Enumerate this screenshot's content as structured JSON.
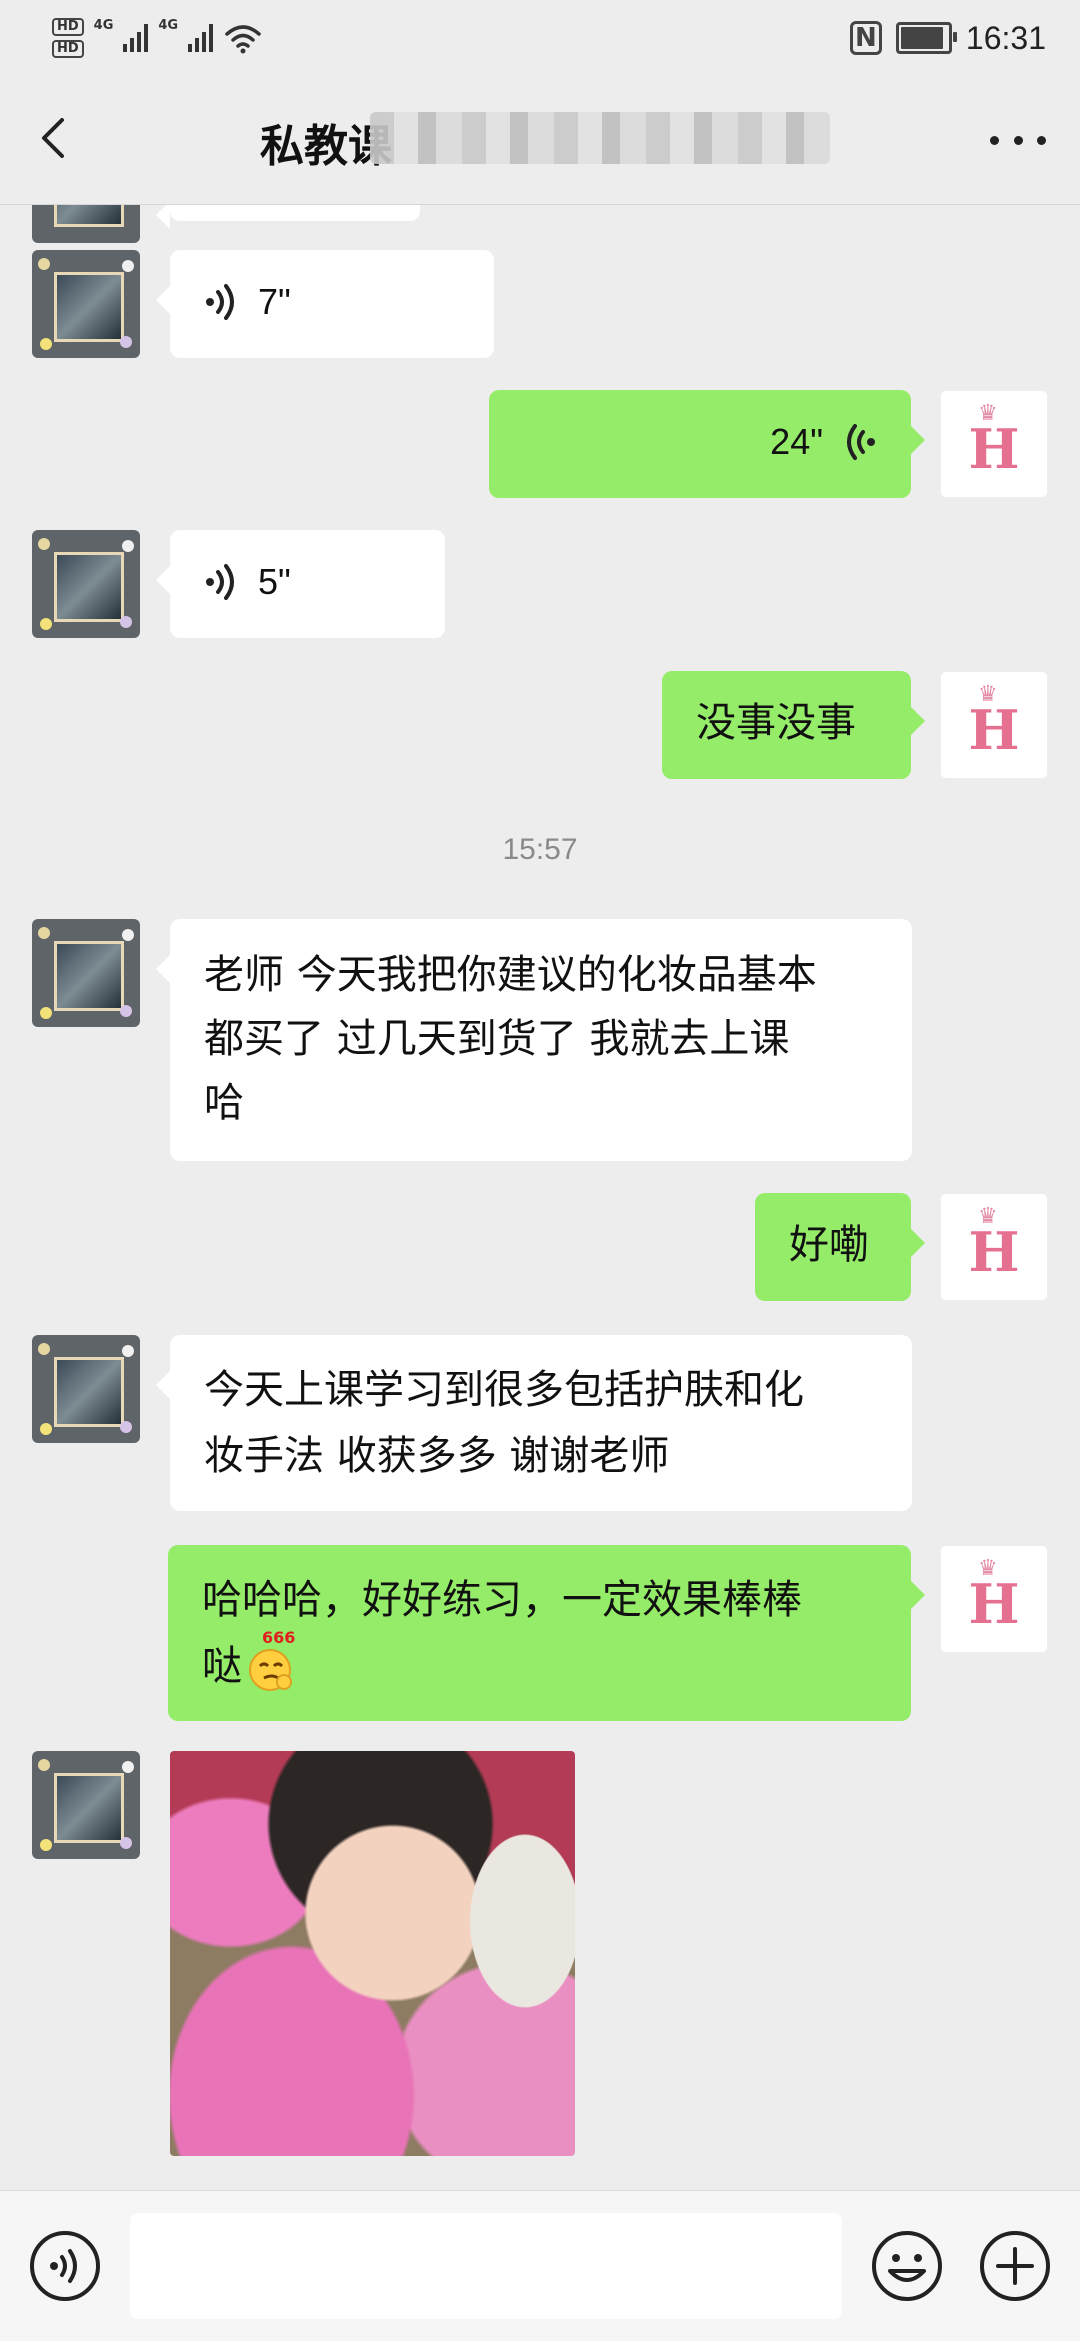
{
  "status_bar": {
    "hd1": "HD",
    "hd2": "HD",
    "net1": "4G",
    "net2": "4G",
    "nfc": "N",
    "time": "16:31"
  },
  "nav": {
    "title": "私教课",
    "more_label": "more options"
  },
  "messages": {
    "m1": {
      "side": "left",
      "type": "voice",
      "duration": "7\""
    },
    "m2": {
      "side": "right",
      "type": "voice",
      "duration": "24\""
    },
    "m3": {
      "side": "left",
      "type": "voice",
      "duration": "5\""
    },
    "m4": {
      "side": "right",
      "type": "text",
      "text": "没事没事"
    },
    "ts1": "15:57",
    "m5": {
      "side": "left",
      "type": "text",
      "lines": [
        "老师 今天我把你建议的化妆品基本",
        "都买了 过几天到货了 我就去上课",
        "哈"
      ]
    },
    "m6": {
      "side": "right",
      "type": "text",
      "text": "好嘞"
    },
    "m7": {
      "side": "left",
      "type": "text",
      "lines": [
        "今天上课学习到很多包括护肤和化",
        "妆手法 收获多多 谢谢老师"
      ]
    },
    "m8": {
      "side": "right",
      "type": "text",
      "lines": [
        "哈哈哈，好好练习，一定效果棒棒",
        "哒"
      ],
      "emoji_label": "666"
    },
    "m9": {
      "side": "left",
      "type": "image"
    }
  },
  "avatars": {
    "right_letter": "H"
  },
  "colors": {
    "background": "#ededed",
    "sent_bubble": "#95ec69",
    "received_bubble": "#ffffff",
    "timestamp": "#8a8a8a"
  }
}
